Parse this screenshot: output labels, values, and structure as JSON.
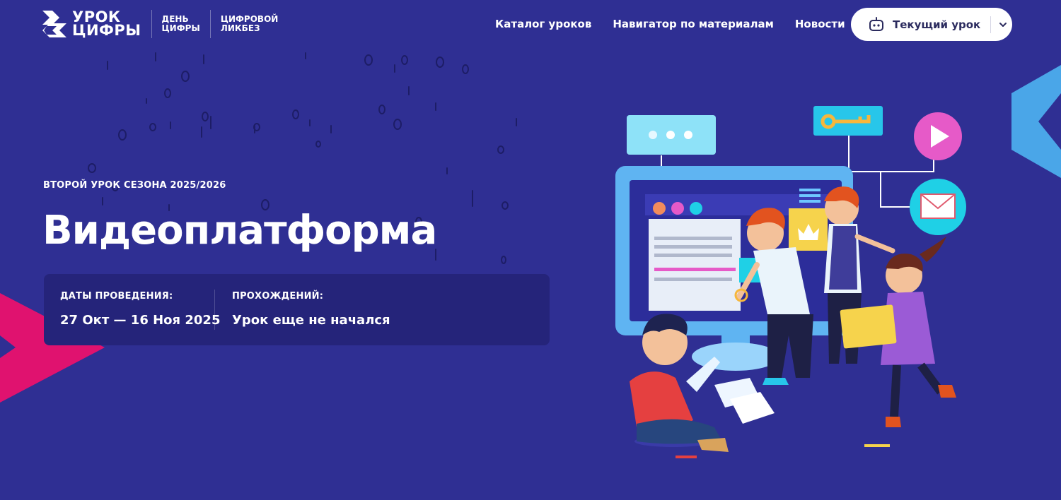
{
  "header": {
    "logo_main_line1": "УРОК",
    "logo_main_line2": "ЦИФРЫ",
    "logo_sub1_line1": "ДЕНЬ",
    "logo_sub1_line2": "ЦИФРЫ",
    "logo_sub2_line1": "ЦИФРОВОЙ",
    "logo_sub2_line2": "ЛИКБЕЗ"
  },
  "nav": {
    "items": [
      {
        "label": "Каталог уроков"
      },
      {
        "label": "Навигатор по материалам"
      },
      {
        "label": "Новости"
      }
    ],
    "current_lesson_label": "Текущий урок"
  },
  "hero": {
    "kicker": "ВТОРОЙ УРОК СЕЗОНА 2025/2026",
    "title": "Видеоплатформа",
    "dates_label": "ДАТЫ ПРОВЕДЕНИЯ:",
    "dates_value": "27 Окт — 16 Ноя 2025",
    "progress_label": "ПРОХОЖДЕНИЙ:",
    "progress_value": "Урок еще не начался"
  },
  "colors": {
    "background": "#2f2f93",
    "panel": "#25247a",
    "accent_pink": "#e0126f",
    "accent_blue": "#4aa6e8"
  },
  "icons": [
    "logo-mark-icon",
    "robot-icon",
    "chevron-down-icon"
  ]
}
